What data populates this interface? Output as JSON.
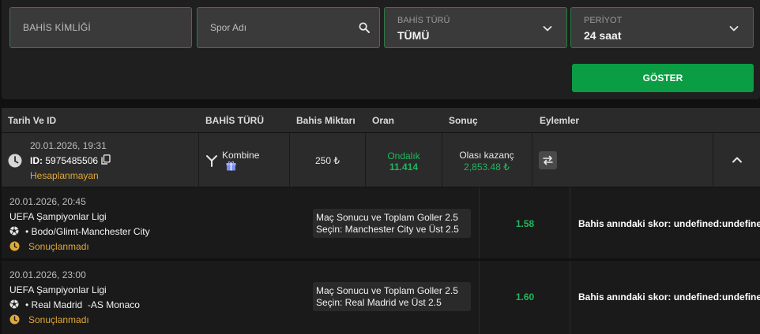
{
  "filters": {
    "bet_id_placeholder": "BAHİS KİMLİĞİ",
    "sport_placeholder": "Spor Adı",
    "bet_type": {
      "label": "BAHİS TÜRÜ",
      "value": "TÜMÜ"
    },
    "period": {
      "label": "PERİYOT",
      "value": "24 saat"
    },
    "show_button": "GÖSTER"
  },
  "table_header": {
    "date_id": "Tarih Ve ID",
    "bet_type": "BAHİS TÜRÜ",
    "amount": "Bahis Miktarı",
    "odds": "Oran",
    "result": "Sonuç",
    "actions": "Eylemler"
  },
  "bet": {
    "date": "20.01.2026, 19:31",
    "id_label": "ID:",
    "id": "5975485506",
    "status": "Hesaplanmayan",
    "type": "Kombine",
    "amount": "250 ₺",
    "odds_label": "Ondalık",
    "odds_value": "11.414",
    "win_label": "Olası kazanç",
    "win_value": "2,853.48 ₺"
  },
  "selections": [
    {
      "date": "20.01.2026, 20:45",
      "league": "UEFA Şampiyonlar Ligi",
      "match": "• Bodo/Glimt-Manchester City",
      "status": "Sonuçlanmadı",
      "market": "Maç Sonucu ve Toplam Goller 2.5",
      "pick": "Seçin: Manchester City ve Üst 2.5",
      "odd": "1.58",
      "score": "Bahis anındaki skor: undefined:undefined"
    },
    {
      "date": "20.01.2026, 23:00",
      "league": "UEFA Şampiyonlar Ligi",
      "match": "• Real Madrid  -AS Monaco",
      "status": "Sonuçlanmadı",
      "market": "Maç Sonucu ve Toplam Goller 2.5",
      "pick": "Seçin: Real Madrid ve Üst 2.5",
      "odd": "1.60",
      "score": "Bahis anındaki skor: undefined:undefined"
    }
  ],
  "icons": {
    "search": "search-icon",
    "chevron": "chevron-down-icon",
    "clock": "clock-icon",
    "copy": "copy-icon",
    "combo": "combo-fork-icon",
    "gift": "gift-icon",
    "cashout": "swap-arrows-icon",
    "collapse": "chevron-up-icon",
    "ball": "soccer-ball-icon"
  },
  "colors": {
    "accent_green": "#0a9d43",
    "odds_green": "#1fb85c",
    "pending_orange": "#e0a838",
    "field_border": "#2f7a47"
  }
}
